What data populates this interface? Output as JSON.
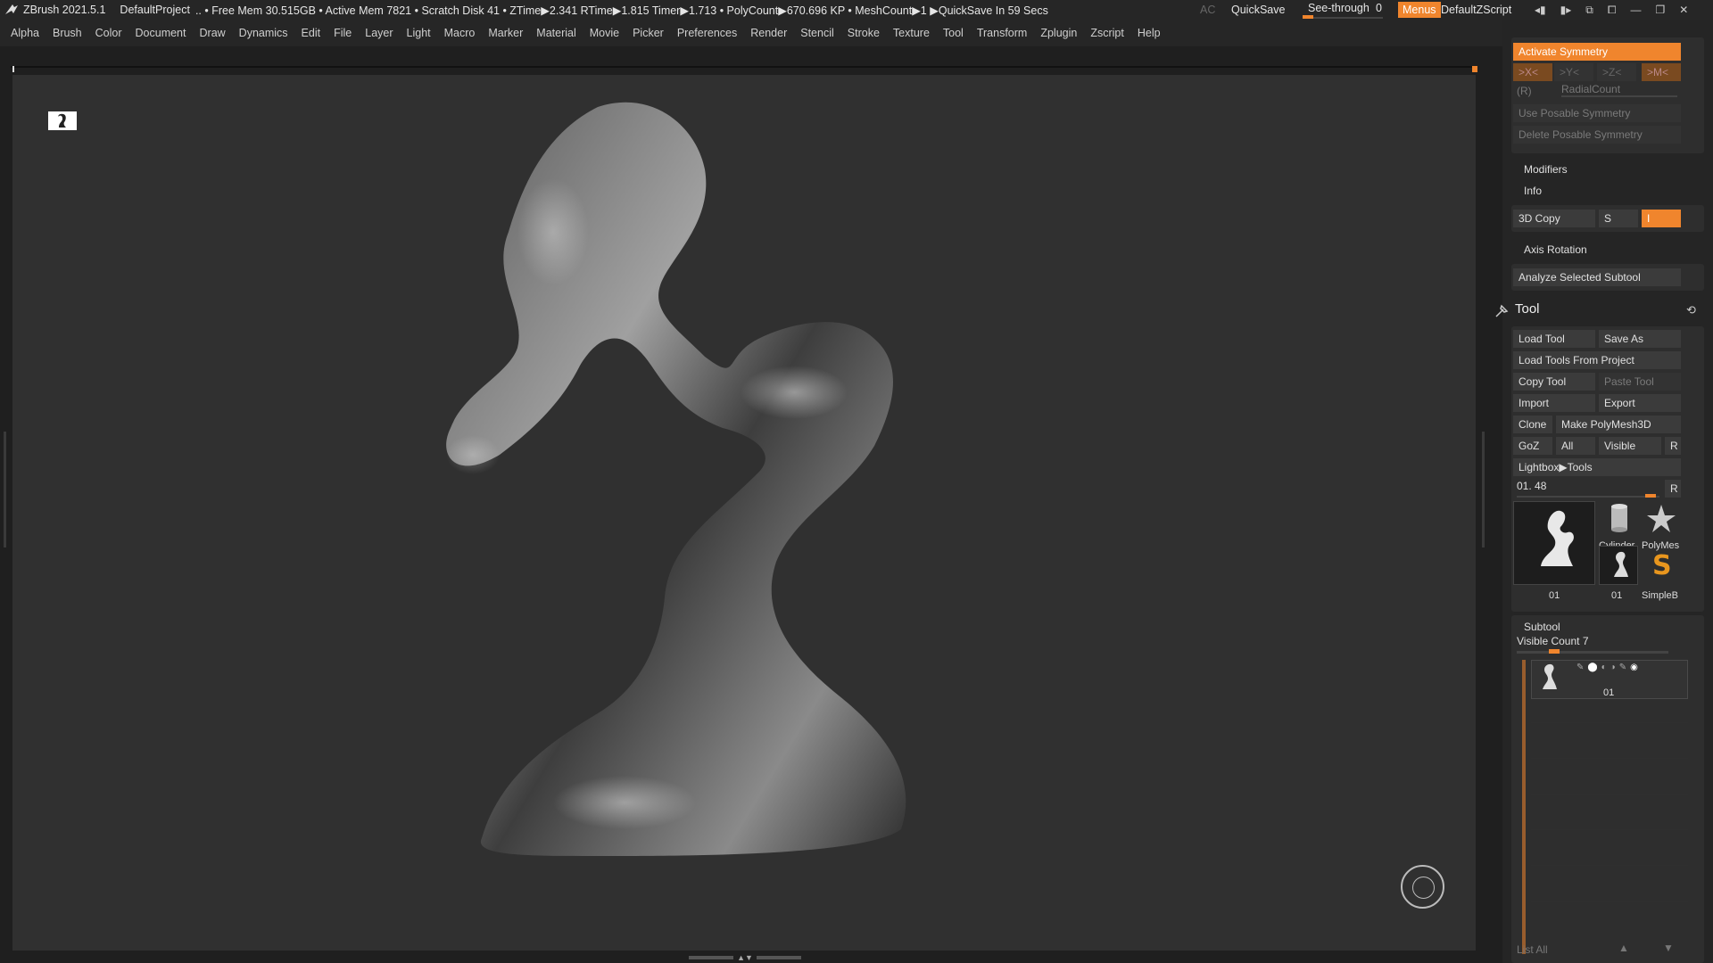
{
  "titlebar": {
    "app": "ZBrush 2021.5.1",
    "project": "DefaultProject",
    "status": ".. • Free Mem 30.515GB • Active Mem 7821 • Scratch Disk 41 • ZTime▶2.341 RTime▶1.815 Timer▶1.713 • PolyCount▶670.696 KP • MeshCount▶1 ▶QuickSave In 59 Secs",
    "ac": "AC",
    "quicksave": "QuickSave",
    "see_through_label": "See-through",
    "see_through_value": "0",
    "menus": "Menus",
    "default_zscript": "DefaultZScript"
  },
  "menubar": [
    "Alpha",
    "Brush",
    "Color",
    "Document",
    "Draw",
    "Dynamics",
    "Edit",
    "File",
    "Layer",
    "Light",
    "Macro",
    "Marker",
    "Material",
    "Movie",
    "Picker",
    "Preferences",
    "Render",
    "Stencil",
    "Stroke",
    "Texture",
    "Tool",
    "Transform",
    "Zplugin",
    "Zscript",
    "Help"
  ],
  "symmetry": {
    "activate": "Activate Symmetry",
    "x": ">X<",
    "y": ">Y<",
    "z": ">Z<",
    "m": ">M<",
    "r": "(R)",
    "radial": "RadialCount",
    "use_posable": "Use Posable Symmetry",
    "delete_posable": "Delete Posable Symmetry"
  },
  "transform": {
    "modifiers": "Modifiers",
    "info": "Info",
    "copy3d": "3D Copy",
    "s": "S",
    "i": "I",
    "axis_rotation": "Axis Rotation",
    "analyze": "Analyze Selected Subtool"
  },
  "tool": {
    "title": "Tool",
    "load_tool": "Load Tool",
    "save_as": "Save As",
    "load_from_project": "Load Tools From Project",
    "copy_tool": "Copy Tool",
    "paste_tool": "Paste Tool",
    "import": "Import",
    "export": "Export",
    "clone": "Clone",
    "make_polymesh": "Make PolyMesh3D",
    "goz": "GoZ",
    "all": "All",
    "visible": "Visible",
    "r": "R",
    "lightbox": "Lightbox▶Tools",
    "current": "01. 48",
    "r2": "R",
    "thumbs": [
      "01",
      "Cylinder",
      "PolyMes",
      "01",
      "SimpleB"
    ]
  },
  "subtool": {
    "title": "Subtool",
    "visible_count": "Visible Count 7",
    "item": "01",
    "list_all": "List All"
  },
  "colors": {
    "accent": "#f0852d",
    "panel": "#252525",
    "canvas": "#303030"
  }
}
